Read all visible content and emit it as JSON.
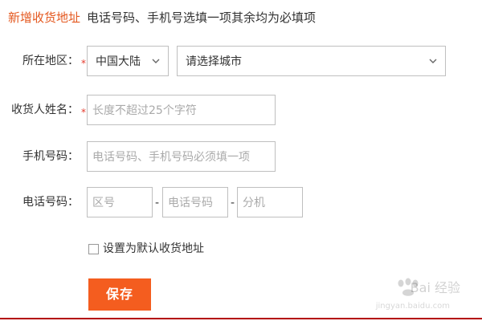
{
  "header": {
    "title": "新增收货地址",
    "note": "电话号码、手机号选填一项其余均为必填项"
  },
  "form": {
    "required_mark": "*",
    "region": {
      "label": "所在地区：",
      "country_value": "中国大陆",
      "city_value": "请选择城市"
    },
    "recipient": {
      "label": "收货人姓名：",
      "placeholder": "长度不超过25个字符"
    },
    "mobile": {
      "label": "手机号码：",
      "placeholder": "电话号码、手机号码必须填一项"
    },
    "phone": {
      "label": "电话号码：",
      "area_placeholder": "区号",
      "number_placeholder": "电话号码",
      "extension_placeholder": "分机",
      "separator": "-"
    },
    "default_checkbox": {
      "label": "设置为默认收货地址",
      "checked": false
    },
    "save_button": "保存"
  },
  "watermark": {
    "text": "Bai  经验",
    "subtext": "jingyan.baidu.com"
  },
  "colors": {
    "accent": "#f45d1f",
    "required": "#e43b2d",
    "border": "#bfbfbf",
    "bottom_line": "#b30000"
  },
  "icons": {
    "dropdown": "chevron-down-icon",
    "watermark": "paw-icon"
  }
}
